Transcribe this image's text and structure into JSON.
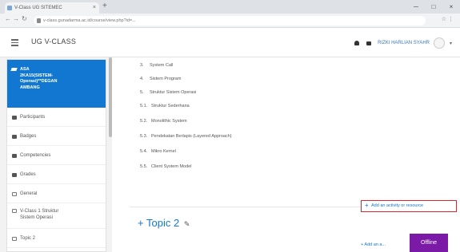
{
  "browser": {
    "tab_title": "V-Class UG SITEMEC",
    "tab_close": "×",
    "new_tab": "+",
    "window_controls": [
      "─",
      "□",
      "×"
    ],
    "url": "v-class.gunadarma.ac.id/course/view.php?id=...",
    "right_icons": "☆ ⋮"
  },
  "navbar": {
    "brand": "UG V-CLASS",
    "user_name": "RIZKI HARLIAN SYAHR",
    "caret": "▾"
  },
  "sidebar": {
    "course": [
      "ASA",
      "2KA15(SISTEM-",
      "Operasi)**DEGAN",
      "AMBANG"
    ],
    "items": [
      {
        "label": "Participants"
      },
      {
        "label": "Badges"
      },
      {
        "label": "Competencies"
      },
      {
        "label": "Grades"
      },
      {
        "label": "General"
      },
      {
        "label": "V-Class 1 Struktur",
        "label2": "Sistem Operasi"
      },
      {
        "label": "Topic 2"
      }
    ]
  },
  "main": {
    "toc": [
      {
        "num": "3.",
        "text": "System Call"
      },
      {
        "num": "4.",
        "text": "Sistem Program"
      },
      {
        "num": "5.",
        "text": "Struktur Sistem Operasi"
      },
      {
        "num": "5.1.",
        "text": "Struktur Sederhana"
      },
      {
        "num": "5.2.",
        "text": "Monolithic System"
      },
      {
        "num": "5.3.",
        "text": "Pendekatan Berlapis (Layered Approach)"
      },
      {
        "num": "5.4.",
        "text": "Mikro Kernel"
      },
      {
        "num": "5.5.",
        "text": "Client System Model"
      }
    ],
    "add_activity_label": "Add an activity or resource",
    "add_plus": "+",
    "topic_title": "Topic 2",
    "topic_plus": "+",
    "edit_icon": "✎",
    "add_activity_label_2": "+ Add an a...",
    "offline_label": "Offline"
  }
}
